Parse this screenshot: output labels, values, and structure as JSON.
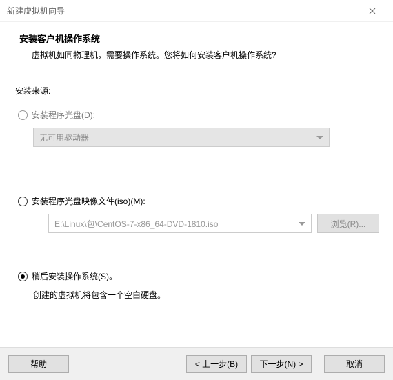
{
  "window": {
    "title": "新建虚拟机向导"
  },
  "header": {
    "title": "安装客户机操作系统",
    "subtitle": "虚拟机如同物理机，需要操作系统。您将如何安装客户机操作系统?"
  },
  "section_label": "安装来源:",
  "options": {
    "disc": {
      "label": "安装程序光盘(D):",
      "dropdown_value": "无可用驱动器",
      "selected": false,
      "enabled": false
    },
    "iso": {
      "label": "安装程序光盘映像文件(iso)(M):",
      "path": "E:\\Linux\\包\\CentOS-7-x86_64-DVD-1810.iso",
      "browse_label": "浏览(R)...",
      "selected": false,
      "enabled": true
    },
    "later": {
      "label": "稍后安装操作系统(S)。",
      "description": "创建的虚拟机将包含一个空白硬盘。",
      "selected": true,
      "enabled": true
    }
  },
  "footer": {
    "help": "帮助",
    "back": "< 上一步(B)",
    "next": "下一步(N) >",
    "cancel": "取消"
  }
}
